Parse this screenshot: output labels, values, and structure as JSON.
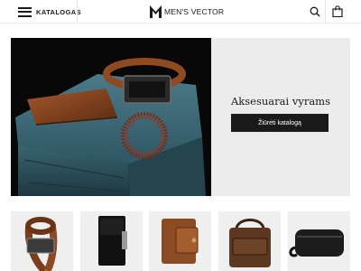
{
  "header": {
    "menu_label": "KATALOGAS",
    "brand_name": "MEN'S VECTOR",
    "icons": {
      "menu": "hamburger-icon",
      "logo": "brand-logo-icon",
      "search": "search-icon",
      "bag": "shopping-bag-icon"
    }
  },
  "hero": {
    "title": "Aksesuarai vyrams",
    "button_label": "Žiūrėti katalogą",
    "accent_color": "#1a1a1a",
    "panel_color": "#ececec"
  },
  "products": [
    {
      "name": "belt"
    },
    {
      "name": "card-holder"
    },
    {
      "name": "brown-wallet"
    },
    {
      "name": "leather-shoulder-bag"
    },
    {
      "name": "black-toiletry-bag"
    }
  ]
}
